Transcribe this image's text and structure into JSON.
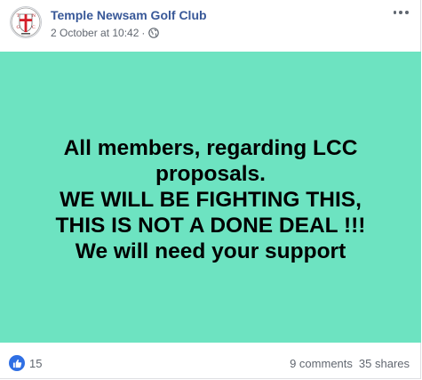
{
  "post": {
    "page_name": "Temple Newsam Golf Club",
    "timestamp": "2 October at 10:42",
    "separator": "·",
    "privacy_icon": "globe-icon",
    "more_icon": "more-options-icon",
    "avatar": {
      "letters": [
        "T",
        "N",
        "G",
        "C"
      ]
    },
    "banner": {
      "background_color": "#6de3c1",
      "lines": [
        "All members, regarding LCC",
        "proposals.",
        "WE WILL BE FIGHTING THIS,",
        "THIS IS NOT A DONE DEAL !!!",
        "We will need your support"
      ]
    },
    "footer": {
      "reaction_icon": "like-icon",
      "reaction_count": "15",
      "comments": "9 comments",
      "shares": "35 shares"
    }
  },
  "colors": {
    "link_blue": "#385898",
    "meta_gray": "#616770",
    "like_blue": "#2f6fe4"
  }
}
